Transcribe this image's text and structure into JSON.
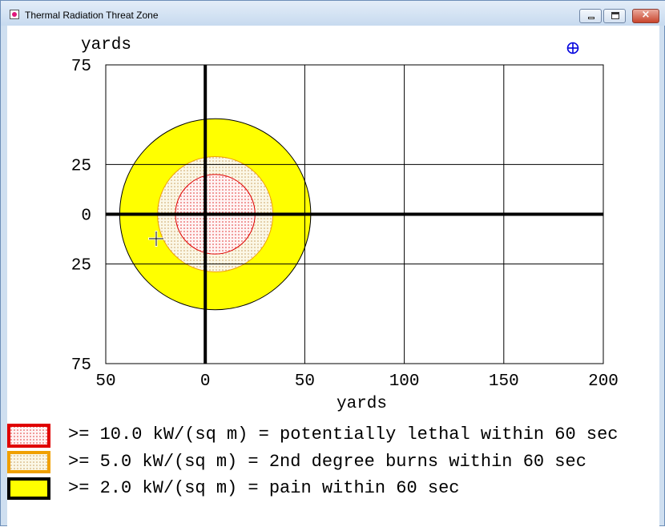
{
  "window": {
    "title": "Thermal Radiation Threat Zone",
    "controls": [
      "minimize",
      "maximize",
      "close"
    ],
    "close_glyph": "×"
  },
  "icons": {
    "app": "threat-zone-app-icon",
    "crosshair": "crosshair-cursor-icon",
    "compass": "circle-plus-marker-icon"
  },
  "colors": {
    "lethal_outline": "#e00000",
    "burns_outline": "#f0a000",
    "pain_fill": "#ffff00",
    "marker": "#0000dd"
  },
  "chart_data": {
    "type": "area",
    "title": "",
    "xlabel": "yards",
    "ylabel": "yards",
    "xlim": [
      -50,
      200
    ],
    "ylim": [
      -75,
      75
    ],
    "xticks": [
      -50,
      0,
      50,
      100,
      150,
      200
    ],
    "yticks": [
      75,
      25,
      0,
      -25,
      -75
    ],
    "xtick_labels": [
      "50",
      "0",
      "50",
      "100",
      "150",
      "200"
    ],
    "ytick_labels": [
      "75",
      "25",
      "0",
      "25",
      "75"
    ],
    "grid": true,
    "legend_position": "bottom",
    "zones": [
      {
        "name": ">= 2.0 kW/(sq m) = pain within 60 sec",
        "center_x": 5,
        "center_y": 0,
        "radius": 48,
        "fill": "#ffff00",
        "border": "#000000"
      },
      {
        "name": ">= 5.0 kW/(sq m) = 2nd degree burns within 60 sec",
        "center_x": 5,
        "center_y": 0,
        "radius": 29,
        "fill": "#f5f0d2",
        "border": "#f0a000"
      },
      {
        "name": ">= 10.0 kW/(sq m) = potentially lethal within 60 sec",
        "center_x": 5,
        "center_y": 0,
        "radius": 20,
        "fill": "#fff0f0",
        "border": "#e00000"
      }
    ],
    "legend": [
      {
        "label": ">= 10.0 kW/(sq m) = potentially lethal within 60 sec",
        "fill": "#fde9e9",
        "border": "#e00000"
      },
      {
        "label": ">= 5.0 kW/(sq m) = 2nd degree burns within 60 sec",
        "fill": "#f3ead0",
        "border": "#f0a000"
      },
      {
        "label": ">= 2.0 kW/(sq m) = pain within 60 sec",
        "fill": "#ffff00",
        "border": "#000000"
      }
    ]
  }
}
